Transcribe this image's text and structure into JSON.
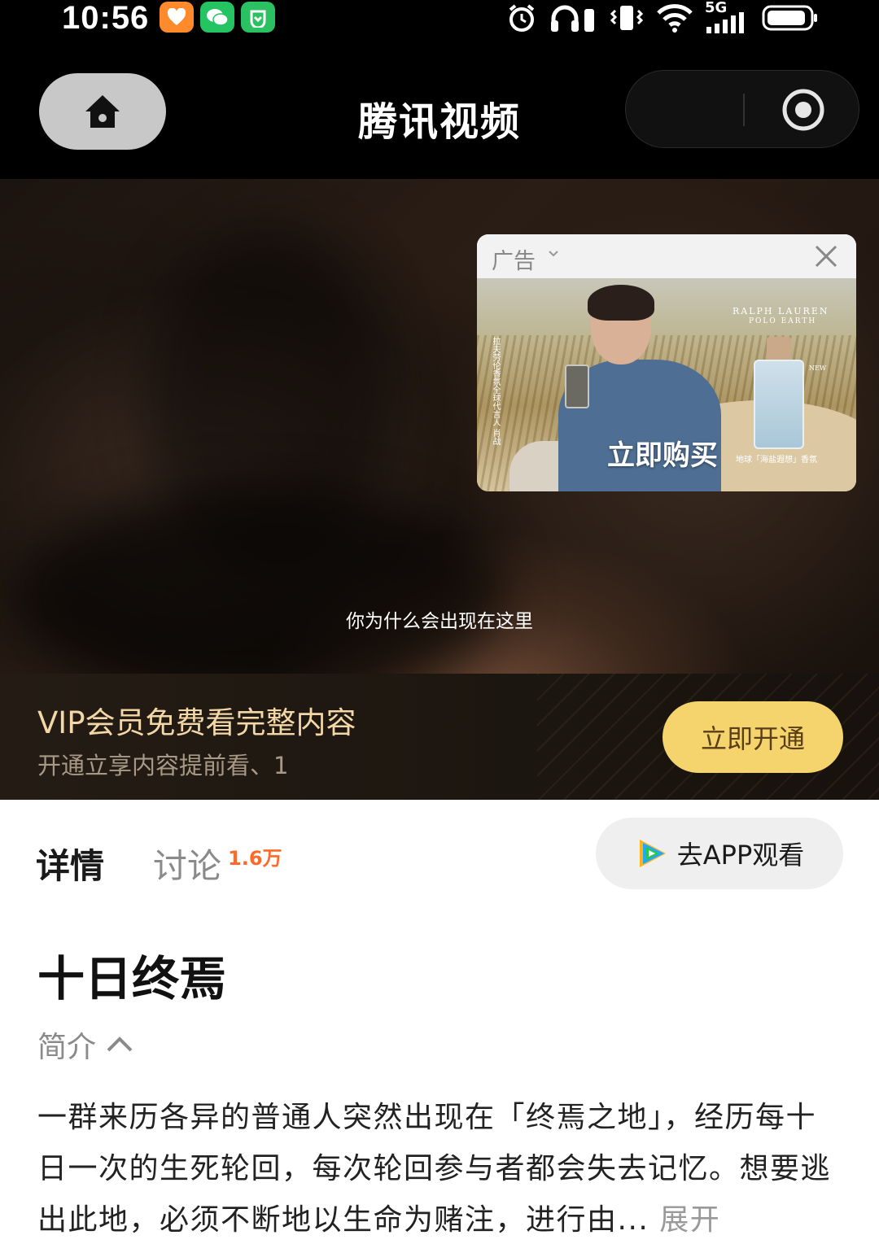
{
  "status_bar": {
    "time": "10:56",
    "network": "5G",
    "colors": {
      "app1": "#ff8a2b",
      "app2": "#24c463",
      "app3": "#2bc163"
    }
  },
  "navbar": {
    "title": "腾讯视频"
  },
  "video": {
    "subtitle": "你为什么会出现在这里"
  },
  "ad": {
    "label": "广告",
    "brand_line1": "RALPH LAUREN",
    "brand_line2": "POLO EARTH",
    "new_tag": "NEW",
    "vertical_text": "拉夫劳伦香氛全球代言人 肖战",
    "buy_label": "立即购买",
    "product_text": "地球「海盐遐想」香氛"
  },
  "vip": {
    "title": "VIP会员免费看完整内容",
    "subtitle": "开通立享内容提前看、1",
    "button_label": "立即开通"
  },
  "tabs": {
    "detail": "详情",
    "discussion": "讨论",
    "discussion_count": "1.6万",
    "app_button": "去APP观看"
  },
  "show": {
    "title": "十日终焉",
    "intro_label": "简介",
    "description": "一群来历各异的普通人突然出现在「终焉之地」，经历每十日一次的生死轮回，每次轮回参与者都会失去记忆。想要逃出此地，必须不断地以生命为赌注，进行由...",
    "expand_label": "展开"
  }
}
